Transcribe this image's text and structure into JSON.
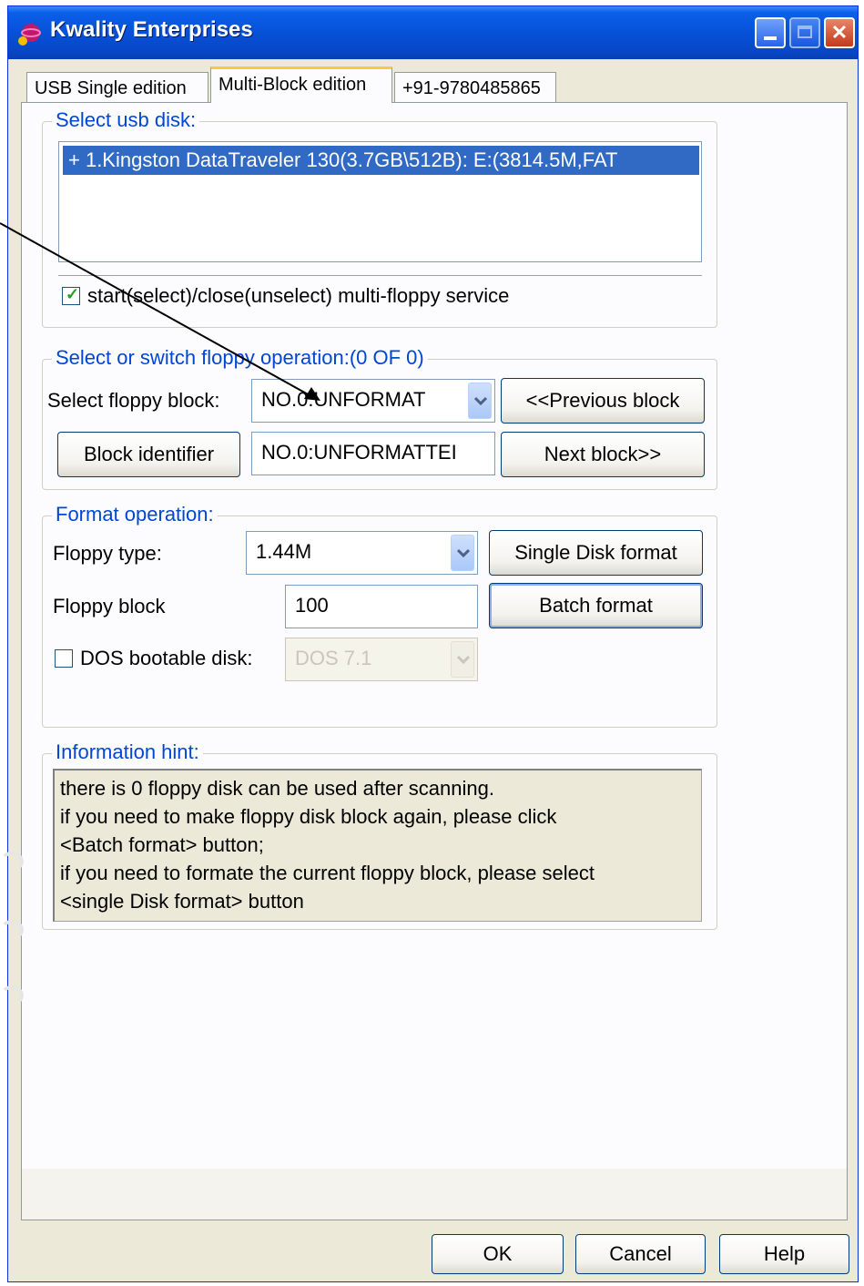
{
  "window": {
    "title": "Kwality Enterprises",
    "icon": "app-globe-icon"
  },
  "tabs": [
    {
      "label": "USB  Single  edition",
      "active": false
    },
    {
      "label": "Multi-Block  edition",
      "active": true
    },
    {
      "label": "+91-9780485865",
      "active": false
    }
  ],
  "usb": {
    "legend": "Select usb disk:",
    "selected_disk": "+ 1.Kingston DataTraveler 130(3.7GB\\512B): E:(3814.5M,FAT",
    "service_checked": true,
    "service_label": "start(select)/close(unselect) multi-floppy service"
  },
  "switch": {
    "legend": "Select or switch floppy operation:(0 OF 0)",
    "select_label": "Select floppy block:",
    "select_value": "NO.0:UNFORMAT",
    "prev_button": "<<Previous block",
    "identifier_button": "Block identifier",
    "identifier_value": "NO.0:UNFORMATTEI",
    "next_button": "Next block>>"
  },
  "format": {
    "legend": "Format operation:",
    "type_label": "Floppy type:",
    "type_value": "1.44M",
    "single_button": "Single Disk format",
    "block_label": "Floppy block",
    "block_value": "100",
    "batch_button": "Batch format",
    "dos_checked": false,
    "dos_label": "DOS bootable disk:",
    "dos_value": "DOS 7.1"
  },
  "hint": {
    "legend": "Information hint:",
    "text": "there is 0 floppy disk can be used after scanning.\n if you need to make floppy disk block again, please click\n<Batch format> button;\n if you need to formate the current floppy block, please select\n<single Disk format> button"
  },
  "footer": {
    "ok": "OK",
    "cancel": "Cancel",
    "help": "Help"
  },
  "colors": {
    "titlebar": "#0751d8",
    "legend": "#0046d5",
    "selection": "#316ac5",
    "check": "#21a121"
  }
}
